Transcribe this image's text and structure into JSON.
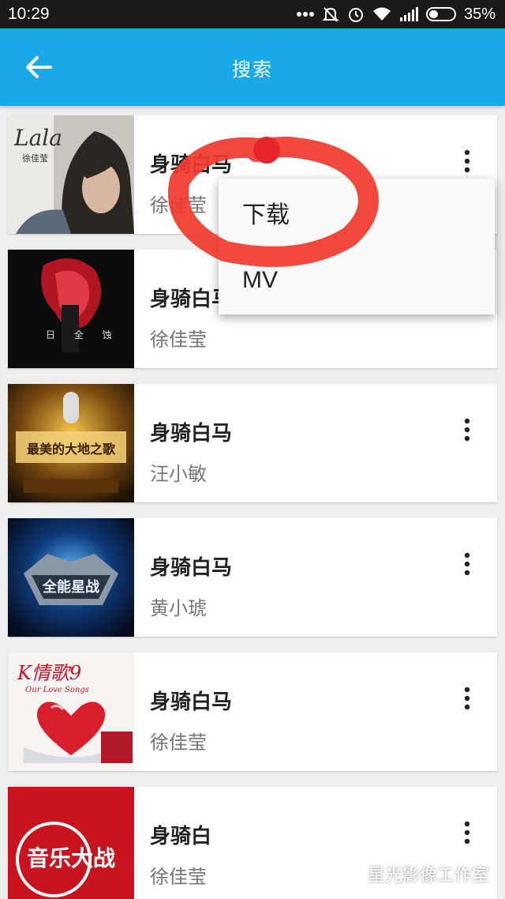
{
  "status_bar": {
    "time": "10:29",
    "battery": "35%",
    "icons": [
      "more-dots-icon",
      "mute-icon",
      "alarm-icon",
      "wifi-icon",
      "signal-icon",
      "battery-icon"
    ]
  },
  "app_bar": {
    "title": "搜索",
    "back_icon": "arrow-left-icon",
    "color": "#19a8e8"
  },
  "results": [
    {
      "title": "身骑白马",
      "artist": "徐佳莹",
      "cover_text": "Lala",
      "cover_sub": "徐佳莹"
    },
    {
      "title": "身骑白马",
      "artist": "徐佳莹",
      "cover_text": "日 全 蚀"
    },
    {
      "title": "身骑白马",
      "artist": "汪小敏",
      "cover_text": "最美的大地之歌"
    },
    {
      "title": "身骑白马",
      "artist": "黄小琥",
      "cover_text": "全能星战"
    },
    {
      "title": "身骑白马",
      "artist": "徐佳莹",
      "cover_text": "K情歌9",
      "cover_sub": "Our Love Songs"
    },
    {
      "title": "身骑白",
      "artist": "徐佳莹",
      "cover_text": "音乐大战"
    }
  ],
  "popup_menu": {
    "items": [
      "下载",
      "MV"
    ]
  },
  "annotation": {
    "color": "#f03a2e"
  },
  "watermark": {
    "text": "星光影像工作室",
    "icon": "wechat-icon"
  }
}
